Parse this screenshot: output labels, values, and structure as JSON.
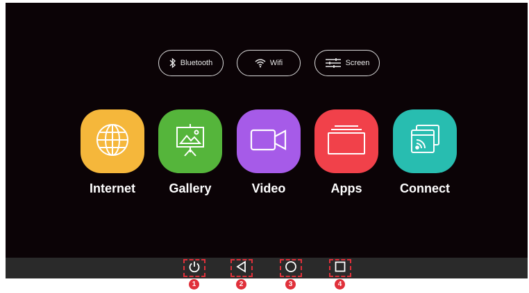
{
  "quick_settings": [
    {
      "label": "Bluetooth",
      "icon": "bluetooth-icon"
    },
    {
      "label": "Wifi",
      "icon": "wifi-icon"
    },
    {
      "label": "Screen",
      "icon": "sliders-icon"
    }
  ],
  "apps": [
    {
      "label": "Internet",
      "icon": "globe-icon",
      "color": "#f5b73b"
    },
    {
      "label": "Gallery",
      "icon": "presentation-icon",
      "color": "#55b53b"
    },
    {
      "label": "Video",
      "icon": "video-camera-icon",
      "color": "#a65be8"
    },
    {
      "label": "Apps",
      "icon": "window-stack-icon",
      "color": "#f1414a"
    },
    {
      "label": "Connect",
      "icon": "cast-icon",
      "color": "#28bdb0"
    }
  ],
  "nav_buttons": [
    {
      "icon": "power-icon",
      "badge": "1"
    },
    {
      "icon": "back-triangle-icon",
      "badge": "2"
    },
    {
      "icon": "home-circle-icon",
      "badge": "3"
    },
    {
      "icon": "recents-square-icon",
      "badge": "4"
    }
  ],
  "colors": {
    "screen_bg": "#0b0306",
    "nav_bar": "#2a2a2a",
    "callout": "#e0303a"
  }
}
